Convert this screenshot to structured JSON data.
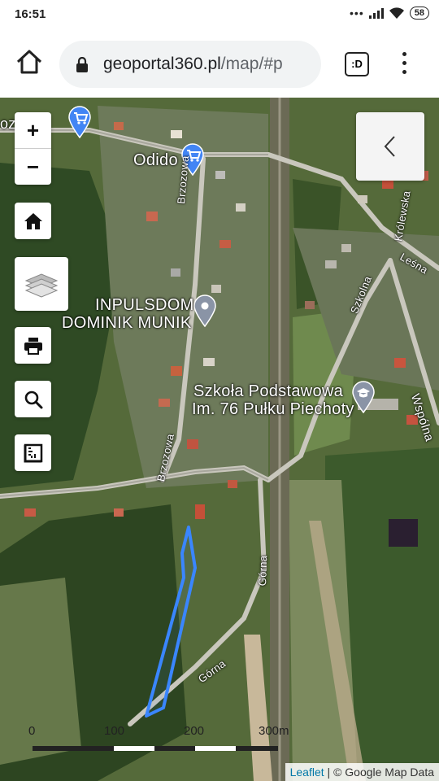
{
  "status_bar": {
    "time": "16:51",
    "battery": "58"
  },
  "browser": {
    "url_host": "geoportal360.pl",
    "url_path": "/map/#p",
    "tabs_label": ":D"
  },
  "map": {
    "zoom_in": "+",
    "zoom_out": "−",
    "places": {
      "odido": "Odido",
      "oz": "oz",
      "inpulsdom_1": "INPULSDOM",
      "inpulsdom_2": "DOMINIK MUNIK",
      "school_1": "Szkoła Podstawowa",
      "school_2": "Im. 76 Pułku Piechoty"
    },
    "streets": {
      "brzozowa_top": "Brzozowa",
      "brzozowa_bottom": "Brzozowa",
      "krolewska": "Królewska",
      "lesna": "Leśna",
      "szkolna": "Szkolna",
      "wspolna": "Wspólna",
      "gorna_vertical": "Górna",
      "gorna_diagonal": "Górna"
    },
    "scale": {
      "label_0": "0",
      "label_100": "100",
      "label_200": "200",
      "label_300": "300m"
    },
    "attribution": {
      "leaflet": "Leaflet",
      "separator": " | ",
      "provider": "© Google Map Data"
    },
    "parcel_color": "#3a86ff"
  }
}
